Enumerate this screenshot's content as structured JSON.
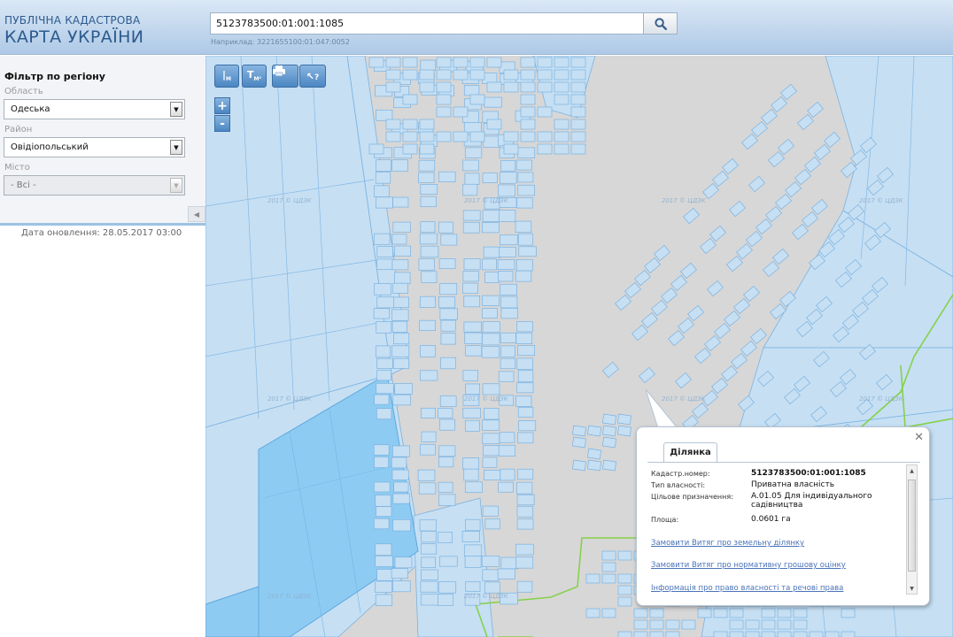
{
  "header": {
    "brand_line1": "ПУБЛІЧНА КАДАСТРОВА",
    "brand_line2": "КАРТА УКРАЇНИ",
    "search_value": "5123783500:01:001:1085",
    "search_hint": "Наприклад: 3221655100:01:047:0052",
    "search_icon": "magnifier-icon"
  },
  "sidebar": {
    "filter_title": "Фільтр по регіону",
    "oblast_label": "Область",
    "oblast_value": "Одеська",
    "rayon_label": "Район",
    "rayon_value": "Овідіопольський",
    "misto_label": "Місто",
    "misto_value": "- Всі -",
    "update_text": "Дата оновлення: 28.05.2017 03:00"
  },
  "map": {
    "tools": [
      "ruler-icon",
      "area-ruler-icon",
      "print-icon",
      "identify-icon"
    ],
    "tool_glyphs": {
      "ruler_sub": "M",
      "area_sub": "M²",
      "identify": "?"
    },
    "zoom_in": "+",
    "zoom_out": "-",
    "watermark": "2017 © ЦДЗК"
  },
  "popup": {
    "tab": "Ділянка",
    "rows": [
      {
        "label": "Кадастр.номер:",
        "value": "5123783500:01:001:1085"
      },
      {
        "label": "Тип власності:",
        "value": "Приватна власність"
      },
      {
        "label": "Цільове призначення:",
        "value": "A.01.05 Для індивідуального садівництва"
      },
      {
        "label": "Площа:",
        "value": "0.0601 га"
      }
    ],
    "links": [
      "Замовити Витяг про земельну ділянку",
      "Замовити Витяг про нормативну грошову оцінку",
      "Інформація про право власності та речові права"
    ]
  },
  "colors": {
    "parcel_fill": "#c6dff3",
    "parcel_stroke": "#7bb2e0",
    "highlight_fill": "#8ecbf2",
    "boundary_green": "#86d14a",
    "header_text": "#2c5a8e",
    "link": "#4a73b8"
  }
}
